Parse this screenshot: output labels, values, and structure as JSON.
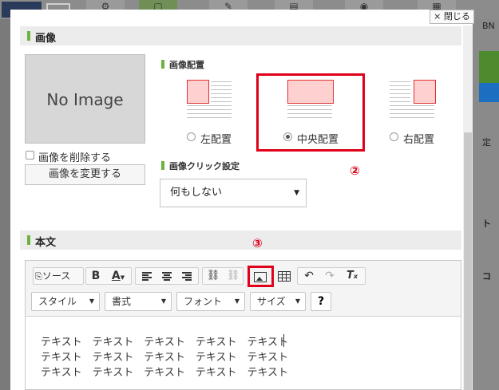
{
  "background": {
    "tabs": [
      {
        "icon": "gear-icon",
        "active": false
      },
      {
        "icon": "window-icon",
        "active": true
      },
      {
        "icon": "edit-icon",
        "active": false
      },
      {
        "icon": "document-icon",
        "active": false
      },
      {
        "icon": "camera-icon",
        "active": false
      },
      {
        "icon": "layout-icon",
        "active": false
      }
    ],
    "side_text": [
      "BN",
      "定",
      "ト",
      "コ"
    ]
  },
  "modal": {
    "close_label": "× 閉じる",
    "image_section": {
      "title": "画像",
      "placeholder": "No Image",
      "delete_label": "画像を削除する",
      "change_button": "画像を変更する",
      "placement_title": "画像配置",
      "placement_options": [
        {
          "label": "左配置",
          "selected": false
        },
        {
          "label": "中央配置",
          "selected": true
        },
        {
          "label": "右配置",
          "selected": false
        }
      ],
      "click_title": "画像クリック設定",
      "click_value": "何もしない"
    },
    "body_section": {
      "title": "本文",
      "toolbar": {
        "source_label": "ソース",
        "bold_label": "B",
        "font_color_label": "A",
        "styles_combo": "スタイル",
        "format_combo": "書式",
        "font_combo": "フォント",
        "size_combo": "サイズ",
        "help_label": "?"
      },
      "content_lines": [
        "テキスト　テキスト　テキスト　テキスト　テキスト",
        "テキスト　テキスト　テキスト　テキスト　テキスト",
        "テキスト　テキスト　テキスト　テキスト　テキスト"
      ]
    },
    "annotations": [
      "②",
      "③"
    ],
    "accent_colors": {
      "green": "#6db33f",
      "red": "#e0001a",
      "pink": "#ffd0d0"
    }
  }
}
